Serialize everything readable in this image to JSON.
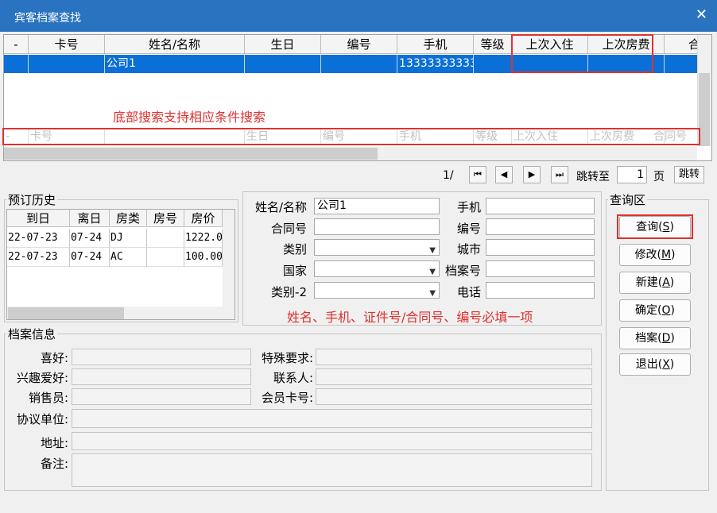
{
  "window": {
    "title": "宾客档案查找",
    "close": "✕"
  },
  "grid": {
    "headers": [
      "-",
      "卡号",
      "姓名/名称",
      "生日",
      "编号",
      "手机",
      "等级",
      "上次入住",
      "上次房费",
      "合"
    ],
    "rows": [
      {
        "card": "",
        "name": "公司1",
        "birthday": "",
        "code": "",
        "mobile": "13333333333",
        "level": "",
        "last_checkin": "",
        "last_fee": ""
      }
    ],
    "filter_row": [
      "-",
      "卡号",
      "",
      "生日",
      "编号",
      "手机",
      "等级",
      "上次入住",
      "上次房费",
      "合同号"
    ]
  },
  "annotations": {
    "search_hint": "底部搜索支持相应条件搜索",
    "required_hint": "姓名、手机、证件号/合同号、编号必填一项"
  },
  "pager": {
    "page_text": "1/",
    "first": "⏮",
    "prev": "◀",
    "next": "▶",
    "last": "⏭",
    "jump_label": "跳转至",
    "page_value": "1",
    "page_unit": "页",
    "jump_button": "跳转"
  },
  "history": {
    "title": "预订历史",
    "headers": [
      "到日",
      "离日",
      "房类",
      "房号",
      "房价"
    ],
    "rows": [
      [
        "22-07-23",
        "07-24",
        "DJ",
        "",
        "1222.0"
      ],
      [
        "22-07-23",
        "07-24",
        "AC",
        "",
        "100.00"
      ]
    ]
  },
  "form": {
    "name_label": "姓名/名称",
    "name_value": "公司1",
    "mobile_label": "手机",
    "mobile_value": "",
    "contract_label": "合同号",
    "contract_value": "",
    "code_label": "编号",
    "code_value": "",
    "category_label": "类别",
    "category_value": "",
    "city_label": "城市",
    "city_value": "",
    "country_label": "国家",
    "country_value": "",
    "archive_no_label": "档案号",
    "archive_no_value": "",
    "category2_label": "类别-2",
    "category2_value": "",
    "phone_label": "电话",
    "phone_value": ""
  },
  "query_area": {
    "title": "查询区",
    "buttons": [
      {
        "label": "查询(",
        "key": "S",
        "tail": ")"
      },
      {
        "label": "修改(",
        "key": "M",
        "tail": ")"
      },
      {
        "label": "新建(",
        "key": "A",
        "tail": ")"
      },
      {
        "label": "确定(",
        "key": "O",
        "tail": ")"
      },
      {
        "label": "档案(",
        "key": "D",
        "tail": ")"
      },
      {
        "label": "退出(",
        "key": "X",
        "tail": ")"
      }
    ]
  },
  "archive": {
    "title": "档案信息",
    "hobby_label": "喜好:",
    "special_label": "特殊要求:",
    "interest_label": "兴趣爱好:",
    "contact_label": "联系人:",
    "sales_label": "销售员:",
    "member_label": "会员卡号:",
    "unit_label": "协议单位:",
    "address_label": "地址:",
    "remark_label": "备注:"
  }
}
